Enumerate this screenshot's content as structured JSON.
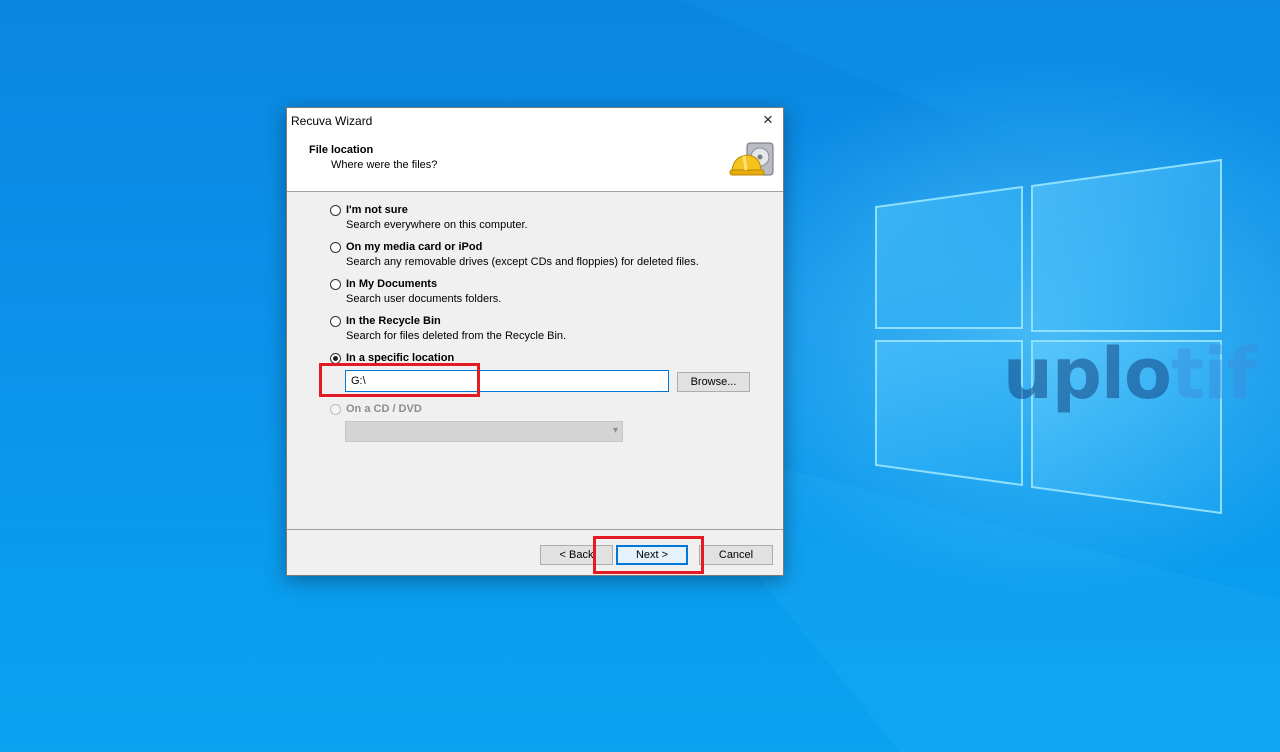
{
  "dialog": {
    "title": "Recuva Wizard",
    "close_label": "×",
    "header": {
      "title": "File location",
      "subtitle": "Where were the files?",
      "icon": "recuva-hardhat-drive-icon"
    },
    "options": [
      {
        "label": "I'm not sure",
        "description": "Search everywhere on this computer.",
        "checked": false
      },
      {
        "label": "On my media card or iPod",
        "description": "Search any removable drives (except CDs and floppies) for deleted files.",
        "checked": false
      },
      {
        "label": "In My Documents",
        "description": "Search user documents folders.",
        "checked": false
      },
      {
        "label": "In the Recycle Bin",
        "description": "Search for files deleted from the Recycle Bin.",
        "checked": false
      },
      {
        "label": "In a specific location",
        "checked": true
      },
      {
        "label": "On a CD / DVD",
        "checked": false,
        "disabled": true
      }
    ],
    "location_input": {
      "value": "G:\\"
    },
    "browse_label": "Browse...",
    "cd_select": {
      "value": ""
    },
    "buttons": {
      "back": "< Back",
      "next": "Next >",
      "cancel": "Cancel"
    }
  },
  "watermark": {
    "part1": "uplo",
    "part2": "tif"
  },
  "colors": {
    "accent": "#0078d7",
    "highlight": "#e21b24",
    "desktop": "#0a8ee6"
  }
}
